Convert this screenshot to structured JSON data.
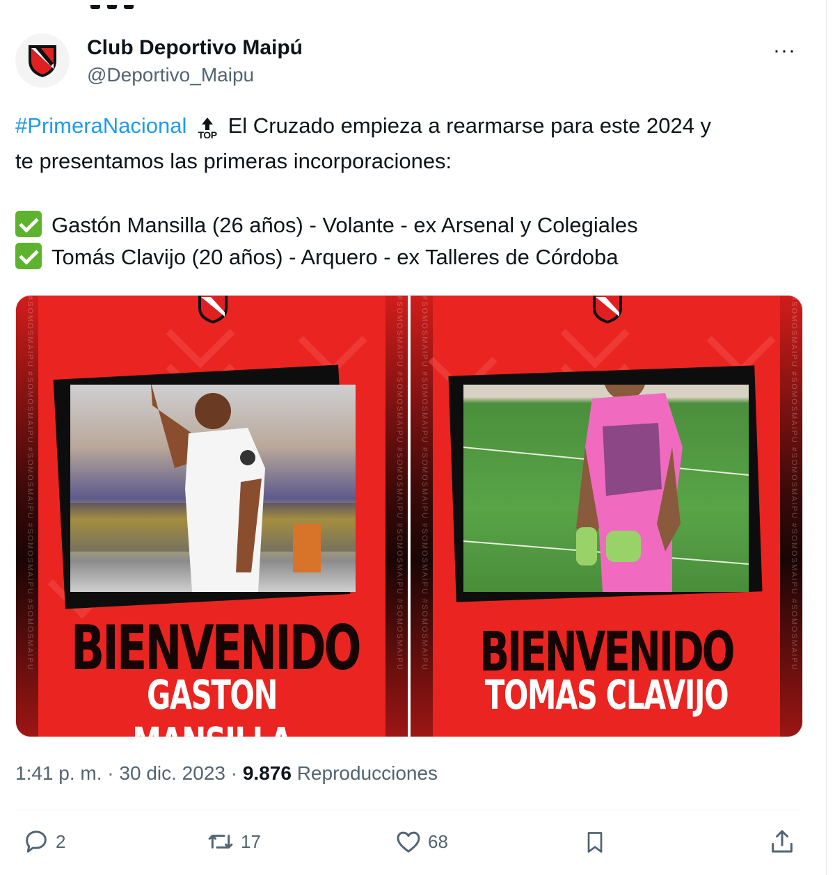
{
  "account": {
    "display_name": "Club Deportivo Maipú",
    "handle": "@Deportivo_Maipu",
    "more_label": "···"
  },
  "tweet": {
    "hashtag": "#PrimeraNacional",
    "emoji_top": "TOP",
    "line1": " El Cruzado empieza a rearmarse para este 2024 y",
    "line2": "te presentamos las primeras incorporaciones:",
    "signings": [
      "Gastón Mansilla (26 años) - Volante - ex Arsenal y Colegiales",
      "Tomás Clavijo (20 años) - Arquero - ex Talleres de Córdoba"
    ]
  },
  "media": [
    {
      "welcome": "BIENVENIDO",
      "player": "GASTON MANSILLA",
      "side_text": "#SOMOSMAIPU #SOMOSMAIPU #SOMOSMAIPU #SOMOSMAIPU #SOMOSMAIPU"
    },
    {
      "welcome": "BIENVENIDO",
      "player": "TOMAS CLAVIJO",
      "side_text": "#SOMOSMAIPU #SOMOSMAIPU #SOMOSMAIPU #SOMOSMAIPU #SOMOSMAIPU"
    }
  ],
  "meta": {
    "time_date": "1:41 p. m. · 30 dic. 2023 · ",
    "views_count": "9.876",
    "views_label": " Reproducciones"
  },
  "actions": {
    "replies": "2",
    "retweets": "17",
    "likes": "68"
  },
  "colors": {
    "accent": "#1d9bf0",
    "card_red": "#ea2420",
    "check_green": "#5db32e"
  }
}
